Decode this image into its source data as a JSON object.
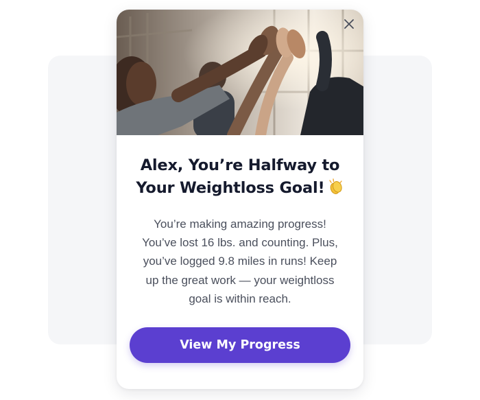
{
  "modal": {
    "close_icon": "close-icon",
    "hero_image": "photo of a group high-fiving",
    "heading_lines": [
      "Alex, You’re Halfway to",
      "Your Weightloss Goal!"
    ],
    "heading_icon": "clapping-hands-icon",
    "body_lines": [
      "You’re making amazing progress!",
      "You’ve lost 16 lbs. and counting. Plus,",
      "you’ve logged 9.8 miles in runs! Keep",
      "up the great work — your weightloss",
      "goal is within reach."
    ],
    "cta_label": "View My Progress"
  },
  "colors": {
    "accent": "#5b3fd0",
    "heading": "#151a2d",
    "body": "#4a4f5c",
    "backdrop_panel": "#f5f6f8"
  }
}
